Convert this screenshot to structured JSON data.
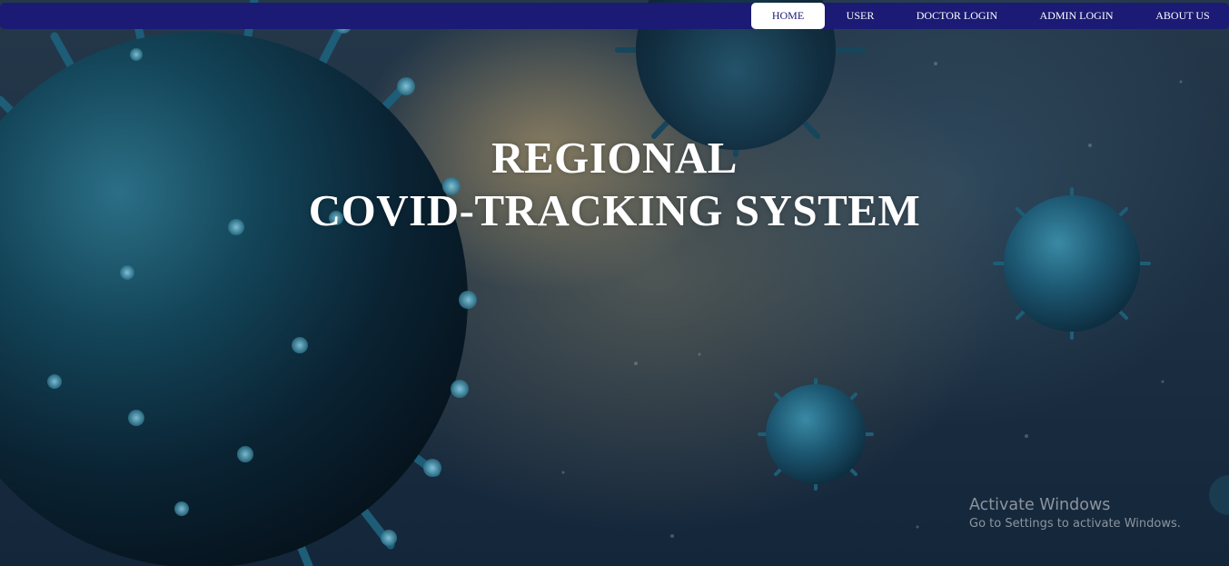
{
  "nav": {
    "items": [
      {
        "label": "HOME",
        "active": true
      },
      {
        "label": "USER",
        "active": false
      },
      {
        "label": "DOCTOR LOGIN",
        "active": false
      },
      {
        "label": "ADMIN LOGIN",
        "active": false
      },
      {
        "label": "ABOUT US",
        "active": false
      }
    ],
    "bar_color": "#1b1a75"
  },
  "hero": {
    "line1": "REGIONAL",
    "line2": "COVID-TRACKING SYSTEM",
    "background_image": "coronavirus-particles"
  },
  "watermark": {
    "title": "Activate Windows",
    "subtitle": "Go to Settings to activate Windows."
  }
}
